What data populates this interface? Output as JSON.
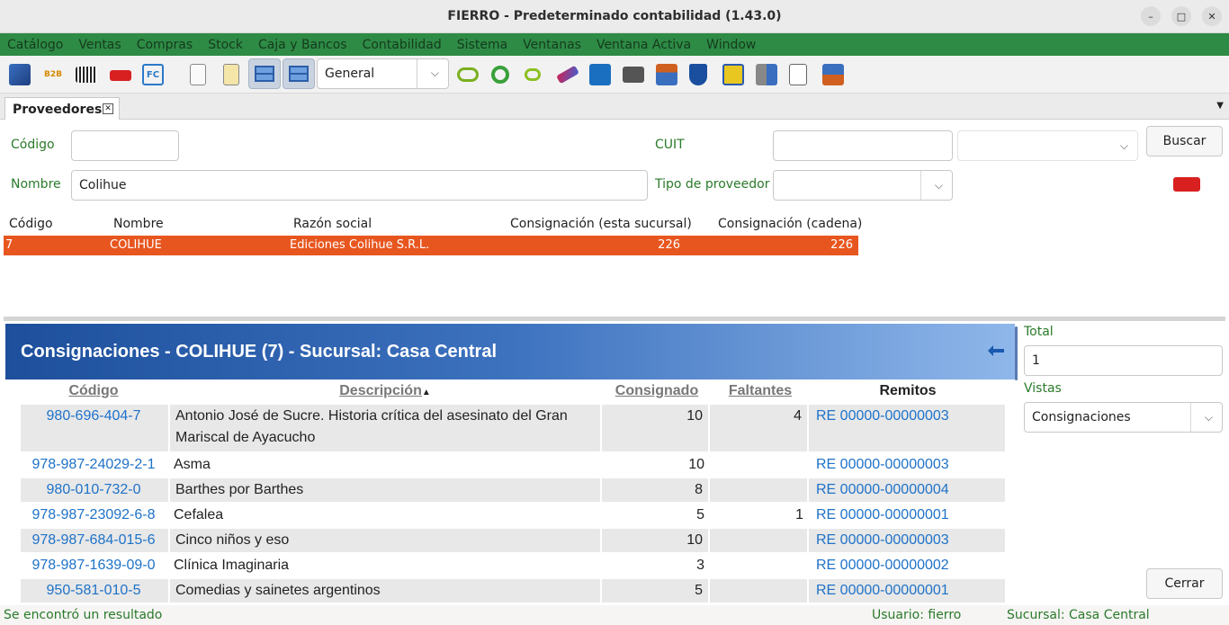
{
  "window": {
    "title": "FIERRO - Predeterminado contabilidad (1.43.0)"
  },
  "menu": [
    "Catálogo",
    "Ventas",
    "Compras",
    "Stock",
    "Caja y Bancos",
    "Contabilidad",
    "Sistema",
    "Ventanas",
    "Ventana Activa",
    "Window"
  ],
  "toolbar": {
    "view_select": "General",
    "icons": [
      "catalog-book-icon",
      "b2b-icon",
      "barcode-icon",
      "truck-icon",
      "fc-invoice-icon",
      "new-document-icon",
      "notes-icon",
      "layout-horizontal-icon",
      "layout-vertical-icon",
      "rings-icon",
      "circle-target-icon",
      "dots-icon",
      "ticket-icon",
      "photo-book-icon",
      "printer-icon",
      "warehouse-icon",
      "shield-icon",
      "shopping-bag-icon",
      "building-icon",
      "document-stack-icon",
      "delivery-icon"
    ]
  },
  "tab": {
    "label": "Proveedores"
  },
  "search": {
    "codigo_label": "Código",
    "codigo_value": "",
    "cuit_label": "CUIT",
    "cuit_value": "",
    "cuit_combo_value": "",
    "nombre_label": "Nombre",
    "nombre_value": "Colihue",
    "tipo_label": "Tipo de proveedor",
    "tipo_value": "",
    "buscar_button": "Buscar"
  },
  "grid": {
    "headers": [
      "Código",
      "Nombre",
      "Razón social",
      "Consignación (esta sucursal)",
      "Consignación (cadena)"
    ],
    "rows": [
      {
        "codigo": "7",
        "nombre": "COLIHUE",
        "razon": "Ediciones Colihue S.R.L.",
        "cons_suc": "226",
        "cons_cad": "226"
      }
    ]
  },
  "report": {
    "title": "Consignaciones - COLIHUE (7) - Sucursal: Casa Central",
    "headers": {
      "codigo": "Código",
      "descripcion": "Descripción",
      "sort_indicator": "▲",
      "consignado": "Consignado",
      "faltantes": "Faltantes",
      "remitos": "Remitos"
    },
    "rows": [
      {
        "codigo": "980-696-404-7",
        "descripcion": "Antonio José de Sucre. Historia crítica del asesinato del Gran Mariscal de Ayacucho",
        "consignado": "10",
        "faltantes": "4",
        "remito": "RE 00000-00000003"
      },
      {
        "codigo": "978-987-24029-2-1",
        "descripcion": "Asma",
        "consignado": "10",
        "faltantes": "",
        "remito": "RE 00000-00000003"
      },
      {
        "codigo": "980-010-732-0",
        "descripcion": "Barthes por Barthes",
        "consignado": "8",
        "faltantes": "",
        "remito": "RE 00000-00000004"
      },
      {
        "codigo": "978-987-23092-6-8",
        "descripcion": "Cefalea",
        "consignado": "5",
        "faltantes": "1",
        "remito": "RE 00000-00000001"
      },
      {
        "codigo": "978-987-684-015-6",
        "descripcion": "Cinco niños y eso",
        "consignado": "10",
        "faltantes": "",
        "remito": "RE 00000-00000003"
      },
      {
        "codigo": "978-987-1639-09-0",
        "descripcion": "Clínica Imaginaria",
        "consignado": "3",
        "faltantes": "",
        "remito": "RE 00000-00000002"
      },
      {
        "codigo": "950-581-010-5",
        "descripcion": "Comedias y sainetes argentinos",
        "consignado": "5",
        "faltantes": "",
        "remito": "RE 00000-00000001"
      }
    ]
  },
  "side": {
    "total_label": "Total",
    "total_value": "1",
    "vistas_label": "Vistas",
    "vistas_value": "Consignaciones",
    "cerrar_button": "Cerrar"
  },
  "status": {
    "message": "Se encontró un resultado",
    "usuario": "Usuario: fierro",
    "sucursal": "Sucursal: Casa Central"
  },
  "colors": {
    "menubar": "#2e8b45",
    "selection": "#e8561f",
    "banner_start": "#1d4f9c",
    "banner_end": "#8fb7ea",
    "link": "#1e72c8",
    "label_green": "#2a7a2a"
  }
}
